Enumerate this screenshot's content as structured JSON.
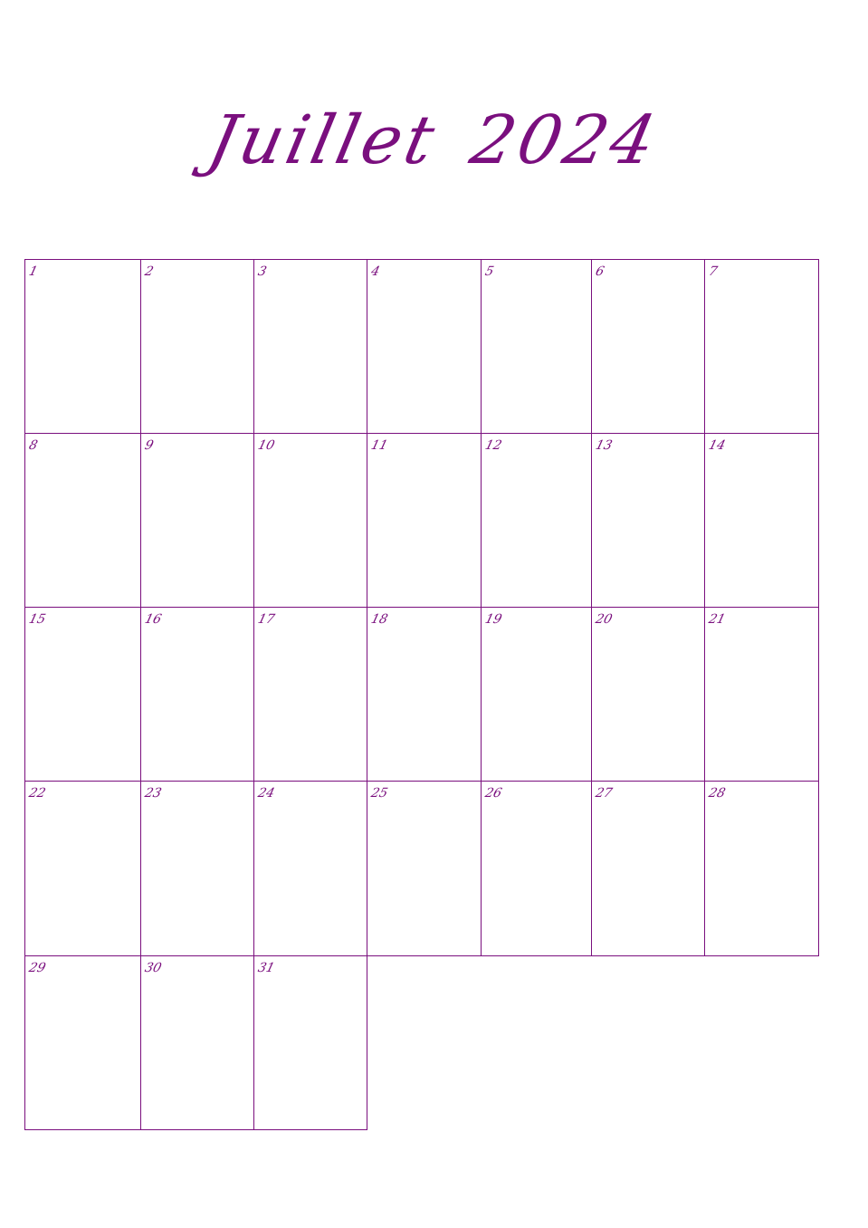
{
  "calendar": {
    "month": "Juillet",
    "year": "2024",
    "accent_color": "#7a0f7e",
    "days": [
      "1",
      "2",
      "3",
      "4",
      "5",
      "6",
      "7",
      "8",
      "9",
      "10",
      "11",
      "12",
      "13",
      "14",
      "15",
      "16",
      "17",
      "18",
      "19",
      "20",
      "21",
      "22",
      "23",
      "24",
      "25",
      "26",
      "27",
      "28",
      "29",
      "30",
      "31"
    ]
  }
}
